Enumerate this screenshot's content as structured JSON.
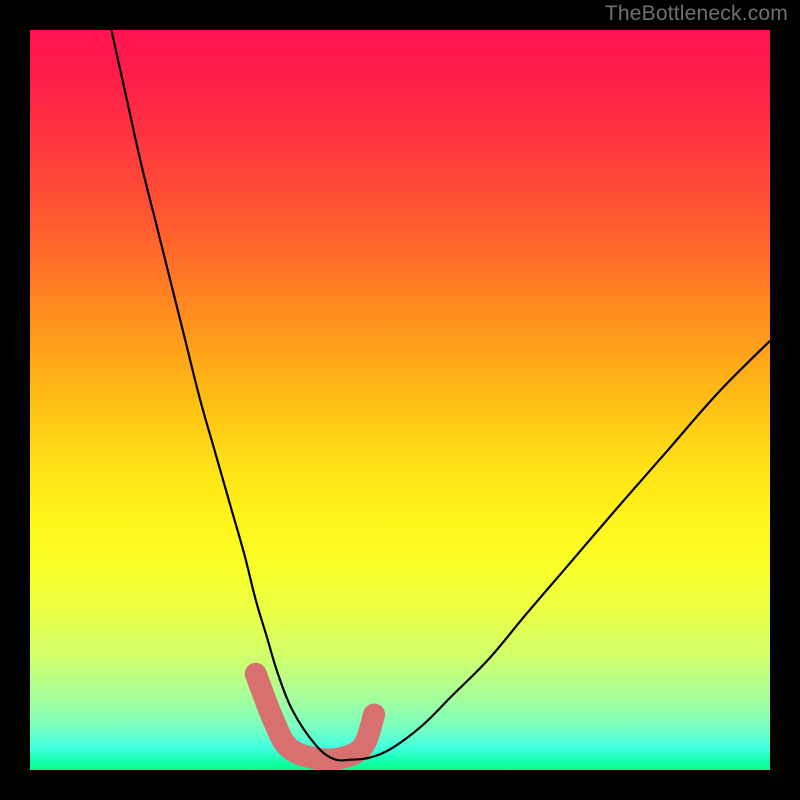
{
  "watermark": "TheBottleneck.com",
  "chart_data": {
    "type": "line",
    "title": "",
    "xlabel": "",
    "ylabel": "",
    "xlim": [
      0,
      100
    ],
    "ylim": [
      0,
      100
    ],
    "legend": false,
    "gradient_colors": {
      "top": "#ff1450",
      "mid": "#fff41a",
      "bottom": "#08ff86"
    },
    "series": [
      {
        "name": "bottleneck-curve",
        "stroke": "#000000",
        "stroke_width": 2,
        "x": [
          11,
          13,
          15,
          17,
          19,
          21,
          23,
          25,
          27,
          29,
          30.5,
          32,
          33.5,
          35.5,
          38.5,
          41,
          43.5,
          46,
          49,
          53,
          57,
          62,
          67,
          73,
          79,
          86,
          93,
          100
        ],
        "y": [
          100,
          91,
          82,
          74,
          66,
          58,
          50,
          43,
          36,
          29,
          23,
          18,
          13,
          8,
          3.5,
          1.5,
          1.4,
          1.7,
          3,
          6,
          10,
          15,
          21,
          28,
          35,
          43,
          51,
          58
        ]
      },
      {
        "name": "highlight-band",
        "stroke": "#d87070",
        "stroke_width": 14,
        "linecap": "round",
        "x": [
          30.5,
          33,
          35,
          38.5,
          42,
          45,
          46.5
        ],
        "y": [
          13,
          6.5,
          3,
          1.6,
          1.6,
          3.2,
          7.5
        ]
      }
    ],
    "annotations": []
  }
}
